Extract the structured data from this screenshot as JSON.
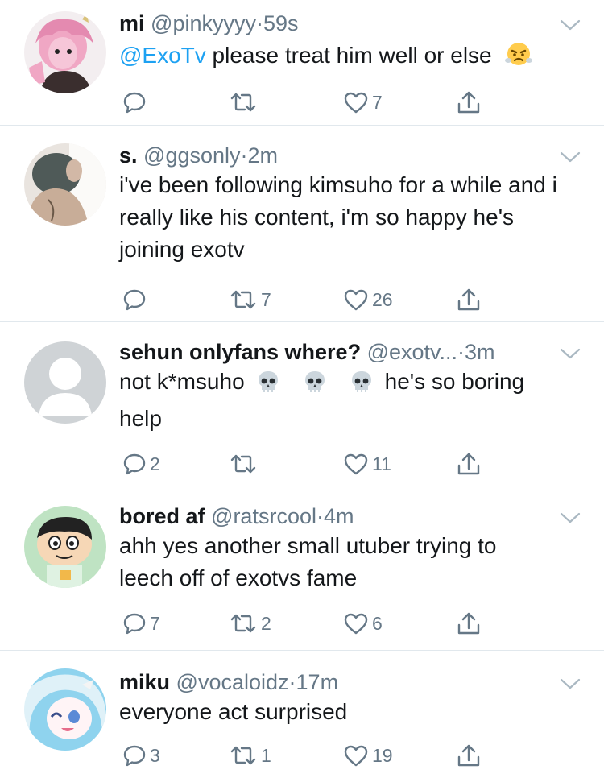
{
  "tweets": [
    {
      "name": "mi",
      "handle": "@pinkyyyy",
      "dot": "·",
      "time": "59s",
      "mention": "@ExoTv",
      "text": " please treat him well or else",
      "reply_count": "",
      "retweet_count": "",
      "like_count": "7",
      "emoji": "face-with-steam-icon"
    },
    {
      "name": "s.",
      "handle": "@ggsonly",
      "dot": "·",
      "time": "2m",
      "text": "i've been following kimsuho for a while and i really like his content, i'm so happy he's joining exotv",
      "reply_count": "",
      "retweet_count": "7",
      "like_count": "26"
    },
    {
      "name": "sehun onlyfans where?",
      "handle": "@exotv...",
      "dot": "·",
      "time": "3m",
      "text_before": "not k*msuho",
      "text_after": "he's so boring",
      "text_line2": "help",
      "reply_count": "2",
      "retweet_count": "",
      "like_count": "11",
      "emoji": "skull-icon"
    },
    {
      "name": "bored af",
      "handle": "@ratsrcool",
      "dot": "·",
      "time": "4m",
      "text": "ahh yes another small utuber trying to leech off of exotvs fame",
      "reply_count": "7",
      "retweet_count": "2",
      "like_count": "6"
    },
    {
      "name": "miku",
      "handle": "@vocaloidz",
      "dot": "·",
      "time": "17m",
      "text": "everyone act surprised",
      "reply_count": "3",
      "retweet_count": "1",
      "like_count": "19"
    }
  ],
  "colors": {
    "accent": "#1da1f2",
    "secondary_text": "#657786",
    "divider": "#e1e8ed"
  }
}
